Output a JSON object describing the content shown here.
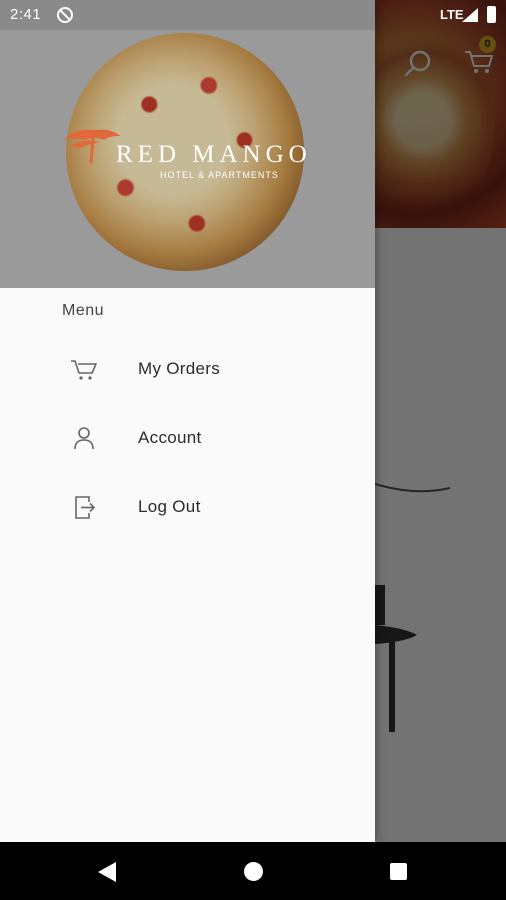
{
  "status_bar": {
    "time": "2:41",
    "network": "LTE",
    "sync_icon": "sync-off-icon",
    "signal_icon": "signal-icon",
    "battery_icon": "battery-icon"
  },
  "background": {
    "cart_badge": "0",
    "search_icon": "search-icon",
    "cart_icon": "cart-icon"
  },
  "drawer": {
    "brand": {
      "name": "RED MANGO",
      "subtitle": "HOTEL & APARTMENTS"
    },
    "menu_heading": "Menu",
    "items": [
      {
        "label": "My Orders",
        "icon": "cart-icon"
      },
      {
        "label": "Account",
        "icon": "person-icon"
      },
      {
        "label": "Log Out",
        "icon": "logout-icon"
      }
    ]
  },
  "nav_bar": {
    "back_icon": "back-icon",
    "home_icon": "home-icon",
    "recents_icon": "recents-icon"
  },
  "colors": {
    "scrim": "#000000",
    "drawer_bg": "#fafafa",
    "header_bg": "#9a9a9a",
    "brand_accent": "#e0683a",
    "badge": "#e0b020"
  }
}
